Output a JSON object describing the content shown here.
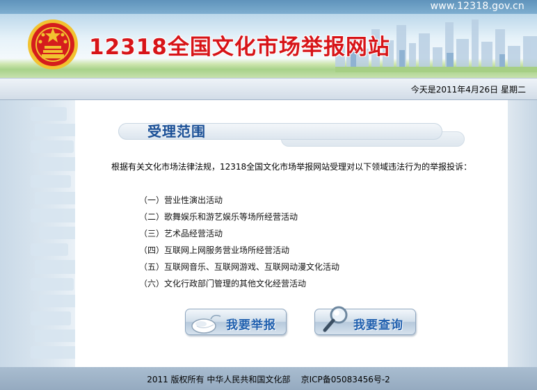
{
  "header": {
    "site_url": "www.12318.gov.cn",
    "site_title": "12318全国文化市场举报网站",
    "emblem_icon": "national-emblem-icon",
    "title_color": "#d71418"
  },
  "date_bar": {
    "text": "今天是2011年4月26日  星期二"
  },
  "main": {
    "section_title": "受理范围",
    "intro": "根据有关文化市场法律法规，12318全国文化市场举报网站受理对以下领域违法行为的举报投诉：",
    "scope_items": [
      "（一）营业性演出活动",
      "（二）歌舞娱乐和游艺娱乐等场所经营活动",
      "（三）艺术品经营活动",
      "（四）互联网上网服务营业场所经营活动",
      "（五）互联网音乐、互联网游戏、互联网动漫文化活动",
      "（六）文化行政部门管理的其他文化经营活动"
    ],
    "report_button": {
      "label": "我要举报",
      "icon": "mouse-icon"
    },
    "query_button": {
      "label": "我要查询",
      "icon": "magnifier-icon"
    },
    "accent_color": "#1f5fae"
  },
  "footer": {
    "text": "2011 版权所有 中华人民共和国文化部    京ICP备05083456号-2"
  }
}
